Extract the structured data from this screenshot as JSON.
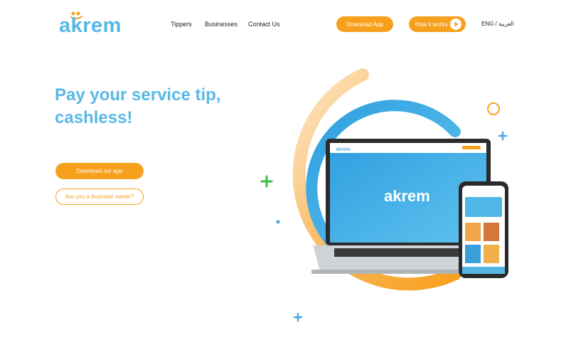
{
  "brand": {
    "logo_text": "akrem",
    "primary_color": "#56b7e6",
    "accent_color": "#f7a01d"
  },
  "nav": {
    "items": [
      "Tippers",
      "Businesses",
      "Contact Us"
    ]
  },
  "header": {
    "download_label": "Download App",
    "how_label": "How it works",
    "lang_label": "ENG / العربية"
  },
  "hero": {
    "title_line1": "Pay your service tip,",
    "title_line2": "cashless!",
    "primary_cta": "Download our app",
    "secondary_cta": "Are you a business owner?"
  },
  "art": {
    "laptop_logo": "akrem",
    "icons": [
      "laptop-illustration",
      "phone-illustration",
      "plus-icon",
      "ring-icon"
    ]
  }
}
